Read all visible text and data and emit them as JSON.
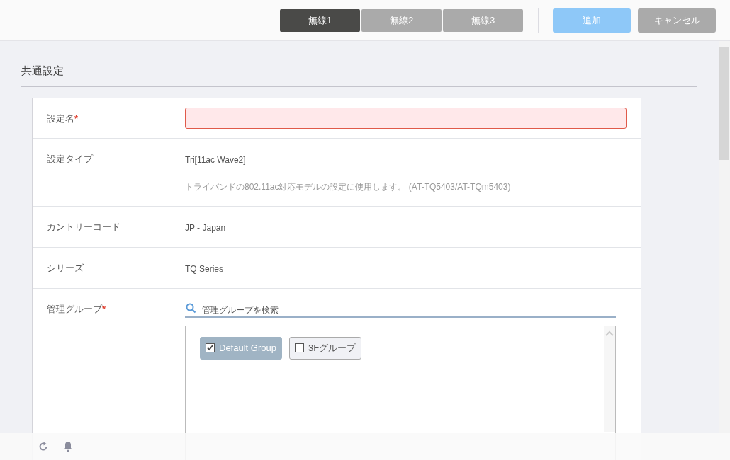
{
  "tabs": [
    {
      "label": "無線1",
      "selected": true
    },
    {
      "label": "無線2",
      "selected": false
    },
    {
      "label": "無線3",
      "selected": false
    }
  ],
  "buttons": [
    {
      "label": "追加",
      "kind": "primary"
    },
    {
      "label": "キャンセル",
      "kind": "secondary"
    }
  ],
  "section_title": "共通設定",
  "fields": [
    {
      "kind": "input",
      "label": "設定名",
      "required_mark": "*",
      "invalid": true
    },
    {
      "kind": "text",
      "label": "設定タイプ",
      "value": "Tri[11ac Wave2]",
      "description": "トライバンドの802.11ac対応モデルの設定に使用します。 (AT-TQ5403/AT-TQm5403)"
    },
    {
      "kind": "text",
      "label": "カントリーコード",
      "value": "JP - Japan"
    },
    {
      "kind": "text",
      "label": "シリーズ",
      "value": "TQ Series"
    },
    {
      "kind": "groups",
      "label": "管理グループ",
      "required_mark": "*",
      "search_placeholder": "管理グループを検索",
      "groups": [
        {
          "label": "Default Group",
          "checked": true
        },
        {
          "label": "3Fグループ",
          "checked": false
        }
      ]
    }
  ]
}
